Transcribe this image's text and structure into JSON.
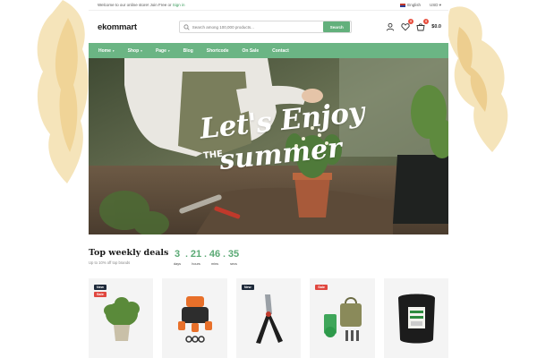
{
  "topbar": {
    "welcome": "Welcome to our online store! Join Free or",
    "signin": "Sign in",
    "language": "English",
    "currency": "USD"
  },
  "header": {
    "logo": "ekommart",
    "search_placeholder": "Search among 100,000 products...",
    "search_button": "Search",
    "wishlist_count": "0",
    "cart_count": "0",
    "cart_total": "$0.0"
  },
  "nav": {
    "items": [
      {
        "label": "Home",
        "has_dropdown": true
      },
      {
        "label": "Shop",
        "has_dropdown": true
      },
      {
        "label": "Page",
        "has_dropdown": true
      },
      {
        "label": "Blog",
        "has_dropdown": false
      },
      {
        "label": "Shortcode",
        "has_dropdown": false
      },
      {
        "label": "On Sale",
        "has_dropdown": false
      },
      {
        "label": "Contact",
        "has_dropdown": false
      }
    ]
  },
  "hero": {
    "line1": "Let's Enjoy",
    "the": "THE",
    "line2": "summer"
  },
  "deals": {
    "title": "Top weekly deals",
    "subtitle": "Up to 10% off top brands",
    "countdown": {
      "days": "3",
      "hours": "21",
      "mins": "46",
      "secs": "35",
      "days_label": "days",
      "hours_label": "hours",
      "mins_label": "mins",
      "secs_label": "secs"
    }
  },
  "products": [
    {
      "name": "potted plant",
      "tags": [
        "New",
        "Sale"
      ]
    },
    {
      "name": "hose splitter",
      "tags": []
    },
    {
      "name": "pruning shears",
      "tags": [
        "New"
      ]
    },
    {
      "name": "garden tool kit",
      "tags": [
        "Sale"
      ]
    },
    {
      "name": "root farm grow bag",
      "tags": []
    }
  ],
  "colors": {
    "brand_green": "#6bb584",
    "countdown_green": "#5aa974",
    "sale_red": "#e0473f",
    "new_navy": "#1e2a3a"
  }
}
